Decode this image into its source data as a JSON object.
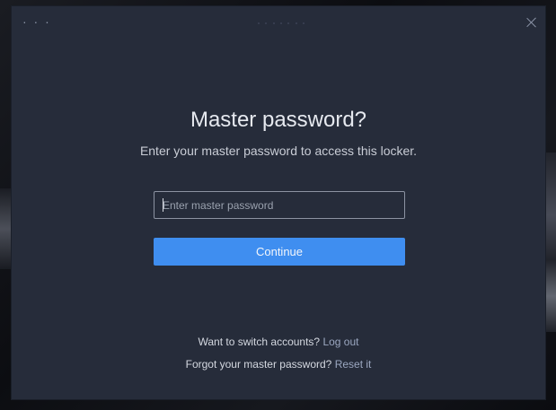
{
  "titlebar": {
    "menu_icon": "more-horizontal-icon",
    "menu_glyph": "· · ·",
    "close_icon": "close-icon"
  },
  "dialog": {
    "title": "Master password?",
    "subtitle": "Enter your master password to access this locker."
  },
  "form": {
    "password_value": "",
    "password_placeholder": "Enter master password",
    "continue_label": "Continue"
  },
  "footer": {
    "switch_prompt": "Want to switch accounts?",
    "switch_link": "Log out",
    "forgot_prompt": "Forgot your master password?",
    "forgot_link": "Reset it"
  },
  "colors": {
    "window_bg": "#262c3a",
    "accent_button": "#3f8ef0",
    "link": "#9ba7c0",
    "input_border": "#8c93a2"
  }
}
